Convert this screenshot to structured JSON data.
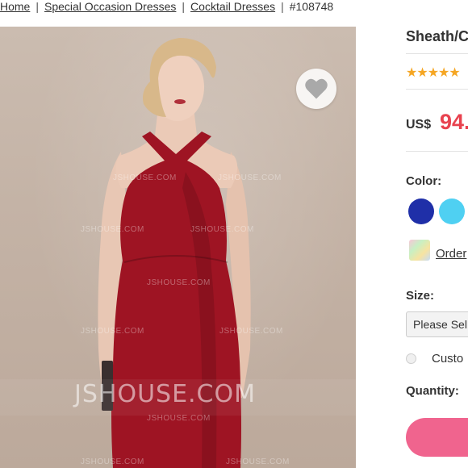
{
  "breadcrumb": {
    "home": "Home",
    "cat1": "Special Occasion Dresses",
    "cat2": "Cocktail Dresses",
    "item_id": "#108748",
    "separator": "|"
  },
  "image": {
    "watermark_big": "JSHOUSE.COM",
    "watermark_small": "JSHOUSE.COM"
  },
  "product": {
    "title": "Sheath/C",
    "stars": "★★★★★",
    "currency": "US$",
    "price": "94."
  },
  "color": {
    "label": "Color:",
    "swatches": [
      {
        "name": "royal-blue",
        "hex": "#1f2fa8"
      },
      {
        "name": "sky-blue",
        "hex": "#4fd0f2"
      }
    ],
    "order_link": "Order"
  },
  "size": {
    "label": "Size:",
    "select_value": "Please Sel",
    "custom_label": "Custo"
  },
  "quantity": {
    "label": "Quantity:"
  },
  "colors": {
    "price": "#e8424f",
    "add_button": "#f0648e",
    "dress": "#9e1423"
  }
}
